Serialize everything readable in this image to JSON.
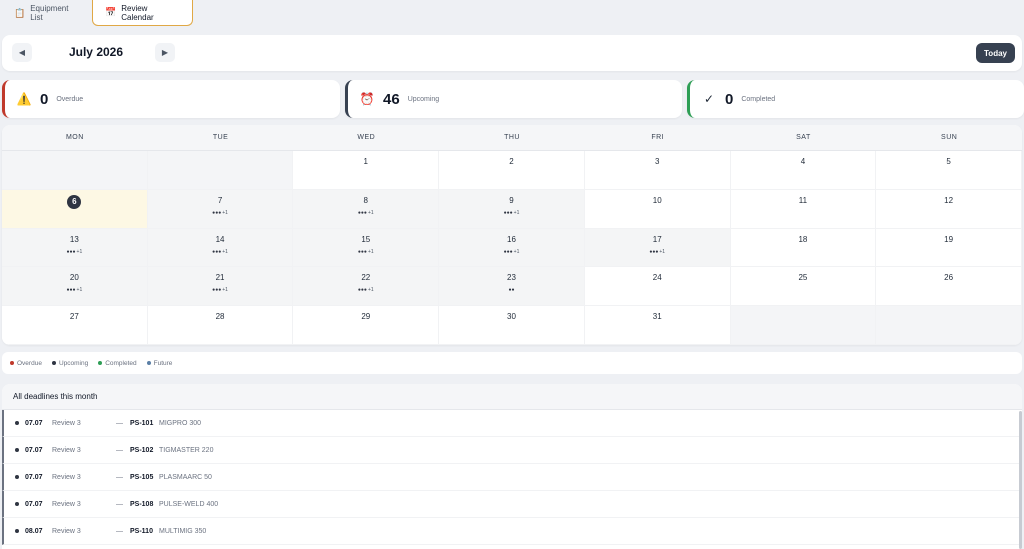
{
  "tabs": [
    {
      "label": "Equipment List",
      "icon": "clipboard-icon",
      "glyph": "📋"
    },
    {
      "label": "Review Calendar",
      "icon": "calendar-icon",
      "glyph": "📅"
    }
  ],
  "header": {
    "month": "July 2026",
    "prev": "◀",
    "next": "▶",
    "today_label": "Today"
  },
  "stats": [
    {
      "count": "0",
      "label": "Overdue",
      "glyph": "⚠️",
      "color": "#c0392b"
    },
    {
      "count": "46",
      "label": "Upcoming",
      "glyph": "⏰",
      "color": "#374151"
    },
    {
      "count": "0",
      "label": "Completed",
      "glyph": "✓",
      "color": "#2e9e55"
    }
  ],
  "calendar": {
    "weekdays": [
      "MON",
      "TUE",
      "WED",
      "THU",
      "FRI",
      "SAT",
      "SUN"
    ],
    "cells": [
      {
        "day": "",
        "dots": "",
        "more": "",
        "state": "blank"
      },
      {
        "day": "",
        "dots": "",
        "more": "",
        "state": "blank"
      },
      {
        "day": "1",
        "dots": "",
        "more": "",
        "state": "normal"
      },
      {
        "day": "2",
        "dots": "",
        "more": "",
        "state": "normal"
      },
      {
        "day": "3",
        "dots": "",
        "more": "",
        "state": "normal"
      },
      {
        "day": "4",
        "dots": "",
        "more": "",
        "state": "normal"
      },
      {
        "day": "5",
        "dots": "",
        "more": "",
        "state": "normal"
      },
      {
        "day": "6",
        "dots": "",
        "more": "",
        "state": "today"
      },
      {
        "day": "7",
        "dots": "●●●",
        "more": "+1",
        "state": "busy"
      },
      {
        "day": "8",
        "dots": "●●●",
        "more": "+1",
        "state": "busy"
      },
      {
        "day": "9",
        "dots": "●●●",
        "more": "+1",
        "state": "busy"
      },
      {
        "day": "10",
        "dots": "",
        "more": "",
        "state": "normal"
      },
      {
        "day": "11",
        "dots": "",
        "more": "",
        "state": "normal"
      },
      {
        "day": "12",
        "dots": "",
        "more": "",
        "state": "normal"
      },
      {
        "day": "13",
        "dots": "●●●",
        "more": "+1",
        "state": "busy"
      },
      {
        "day": "14",
        "dots": "●●●",
        "more": "+1",
        "state": "busy"
      },
      {
        "day": "15",
        "dots": "●●●",
        "more": "+1",
        "state": "busy"
      },
      {
        "day": "16",
        "dots": "●●●",
        "more": "+1",
        "state": "busy"
      },
      {
        "day": "17",
        "dots": "●●●",
        "more": "+1",
        "state": "busy"
      },
      {
        "day": "18",
        "dots": "",
        "more": "",
        "state": "normal"
      },
      {
        "day": "19",
        "dots": "",
        "more": "",
        "state": "normal"
      },
      {
        "day": "20",
        "dots": "●●●",
        "more": "+1",
        "state": "busy"
      },
      {
        "day": "21",
        "dots": "●●●",
        "more": "+1",
        "state": "busy"
      },
      {
        "day": "22",
        "dots": "●●●",
        "more": "+1",
        "state": "busy"
      },
      {
        "day": "23",
        "dots": "●●",
        "more": "",
        "state": "busy"
      },
      {
        "day": "24",
        "dots": "",
        "more": "",
        "state": "normal"
      },
      {
        "day": "25",
        "dots": "",
        "more": "",
        "state": "normal"
      },
      {
        "day": "26",
        "dots": "",
        "more": "",
        "state": "normal"
      },
      {
        "day": "27",
        "dots": "",
        "more": "",
        "state": "normal"
      },
      {
        "day": "28",
        "dots": "",
        "more": "",
        "state": "normal"
      },
      {
        "day": "29",
        "dots": "",
        "more": "",
        "state": "normal"
      },
      {
        "day": "30",
        "dots": "",
        "more": "",
        "state": "normal"
      },
      {
        "day": "31",
        "dots": "",
        "more": "",
        "state": "normal"
      },
      {
        "day": "",
        "dots": "",
        "more": "",
        "state": "blank"
      },
      {
        "day": "",
        "dots": "",
        "more": "",
        "state": "blank"
      }
    ]
  },
  "legend": [
    {
      "label": "Overdue",
      "color": "#c0392b"
    },
    {
      "label": "Upcoming",
      "color": "#2f3542"
    },
    {
      "label": "Completed",
      "color": "#2e9e55"
    },
    {
      "label": "Future",
      "color": "#5b7fa6"
    }
  ],
  "deadlines": {
    "title": "All deadlines this month",
    "rows": [
      {
        "date": "07.07",
        "review": "Review 3",
        "dash": "—",
        "code": "PS-101",
        "name": "MIGPRO 300"
      },
      {
        "date": "07.07",
        "review": "Review 3",
        "dash": "—",
        "code": "PS-102",
        "name": "TIGMASTER 220"
      },
      {
        "date": "07.07",
        "review": "Review 3",
        "dash": "—",
        "code": "PS-105",
        "name": "PLASMAARC 50"
      },
      {
        "date": "07.07",
        "review": "Review 3",
        "dash": "—",
        "code": "PS-108",
        "name": "PULSE-WELD 400"
      },
      {
        "date": "08.07",
        "review": "Review 3",
        "dash": "—",
        "code": "PS-110",
        "name": "MULTIMIG 350"
      }
    ]
  }
}
